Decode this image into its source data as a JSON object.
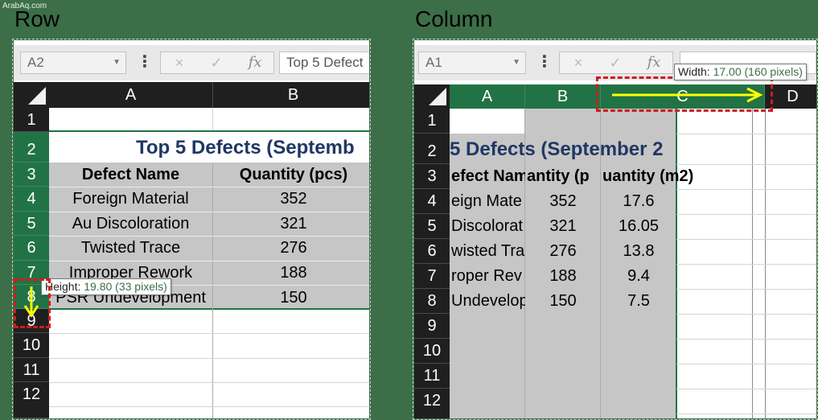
{
  "watermark": "ArabAq.com",
  "colors": {
    "accent_green": "#217346",
    "title_blue": "#1f3864",
    "highlight_red": "#d11b1b",
    "arrow_yellow": "#ffff00"
  },
  "left": {
    "heading": "Row",
    "name_box": "A2",
    "formula": "Top 5 Defect",
    "fx_label": "fx",
    "cancel_icon": "×",
    "enter_icon": "✓",
    "columns": [
      "A",
      "B"
    ],
    "rows": [
      "1",
      "2",
      "3",
      "4",
      "5",
      "6",
      "7",
      "8",
      "9",
      "10",
      "11",
      "12"
    ],
    "title": "Top 5 Defects (Septemb",
    "headers": [
      "Defect Name",
      "Quantity (pcs)"
    ],
    "data": [
      [
        "Foreign Material",
        "352"
      ],
      [
        "Au Discoloration",
        "321"
      ],
      [
        "Twisted Trace",
        "276"
      ],
      [
        "Improper Rework",
        "188"
      ],
      [
        "PSR Undevelopment",
        "150"
      ]
    ],
    "tooltip_prefix": "Height: ",
    "tooltip_value": "19.80 (33 pixels)",
    "resize_arrow_icon": "arrow-down-icon"
  },
  "right": {
    "heading": "Column",
    "name_box": "A1",
    "fx_label": "fx",
    "cancel_icon": "×",
    "enter_icon": "✓",
    "columns": [
      "A",
      "B",
      "C",
      "D"
    ],
    "rows": [
      "1",
      "2",
      "3",
      "4",
      "5",
      "6",
      "7",
      "8",
      "9",
      "10",
      "11",
      "12"
    ],
    "title": "5 Defects (September 2",
    "headers": [
      "efect Nam",
      "antity (p",
      "uantity (m2)"
    ],
    "data": [
      [
        "eign Mate",
        "352",
        "17.6"
      ],
      [
        "Discolorat",
        "321",
        "16.05"
      ],
      [
        "wisted Tra",
        "276",
        "13.8"
      ],
      [
        "roper Rev",
        "188",
        "9.4"
      ],
      [
        "Undevelop",
        "150",
        "7.5"
      ]
    ],
    "tooltip_prefix": "Width: ",
    "tooltip_value": "17.00 (160 pixels)",
    "resize_arrow_icon": "arrow-right-icon"
  }
}
